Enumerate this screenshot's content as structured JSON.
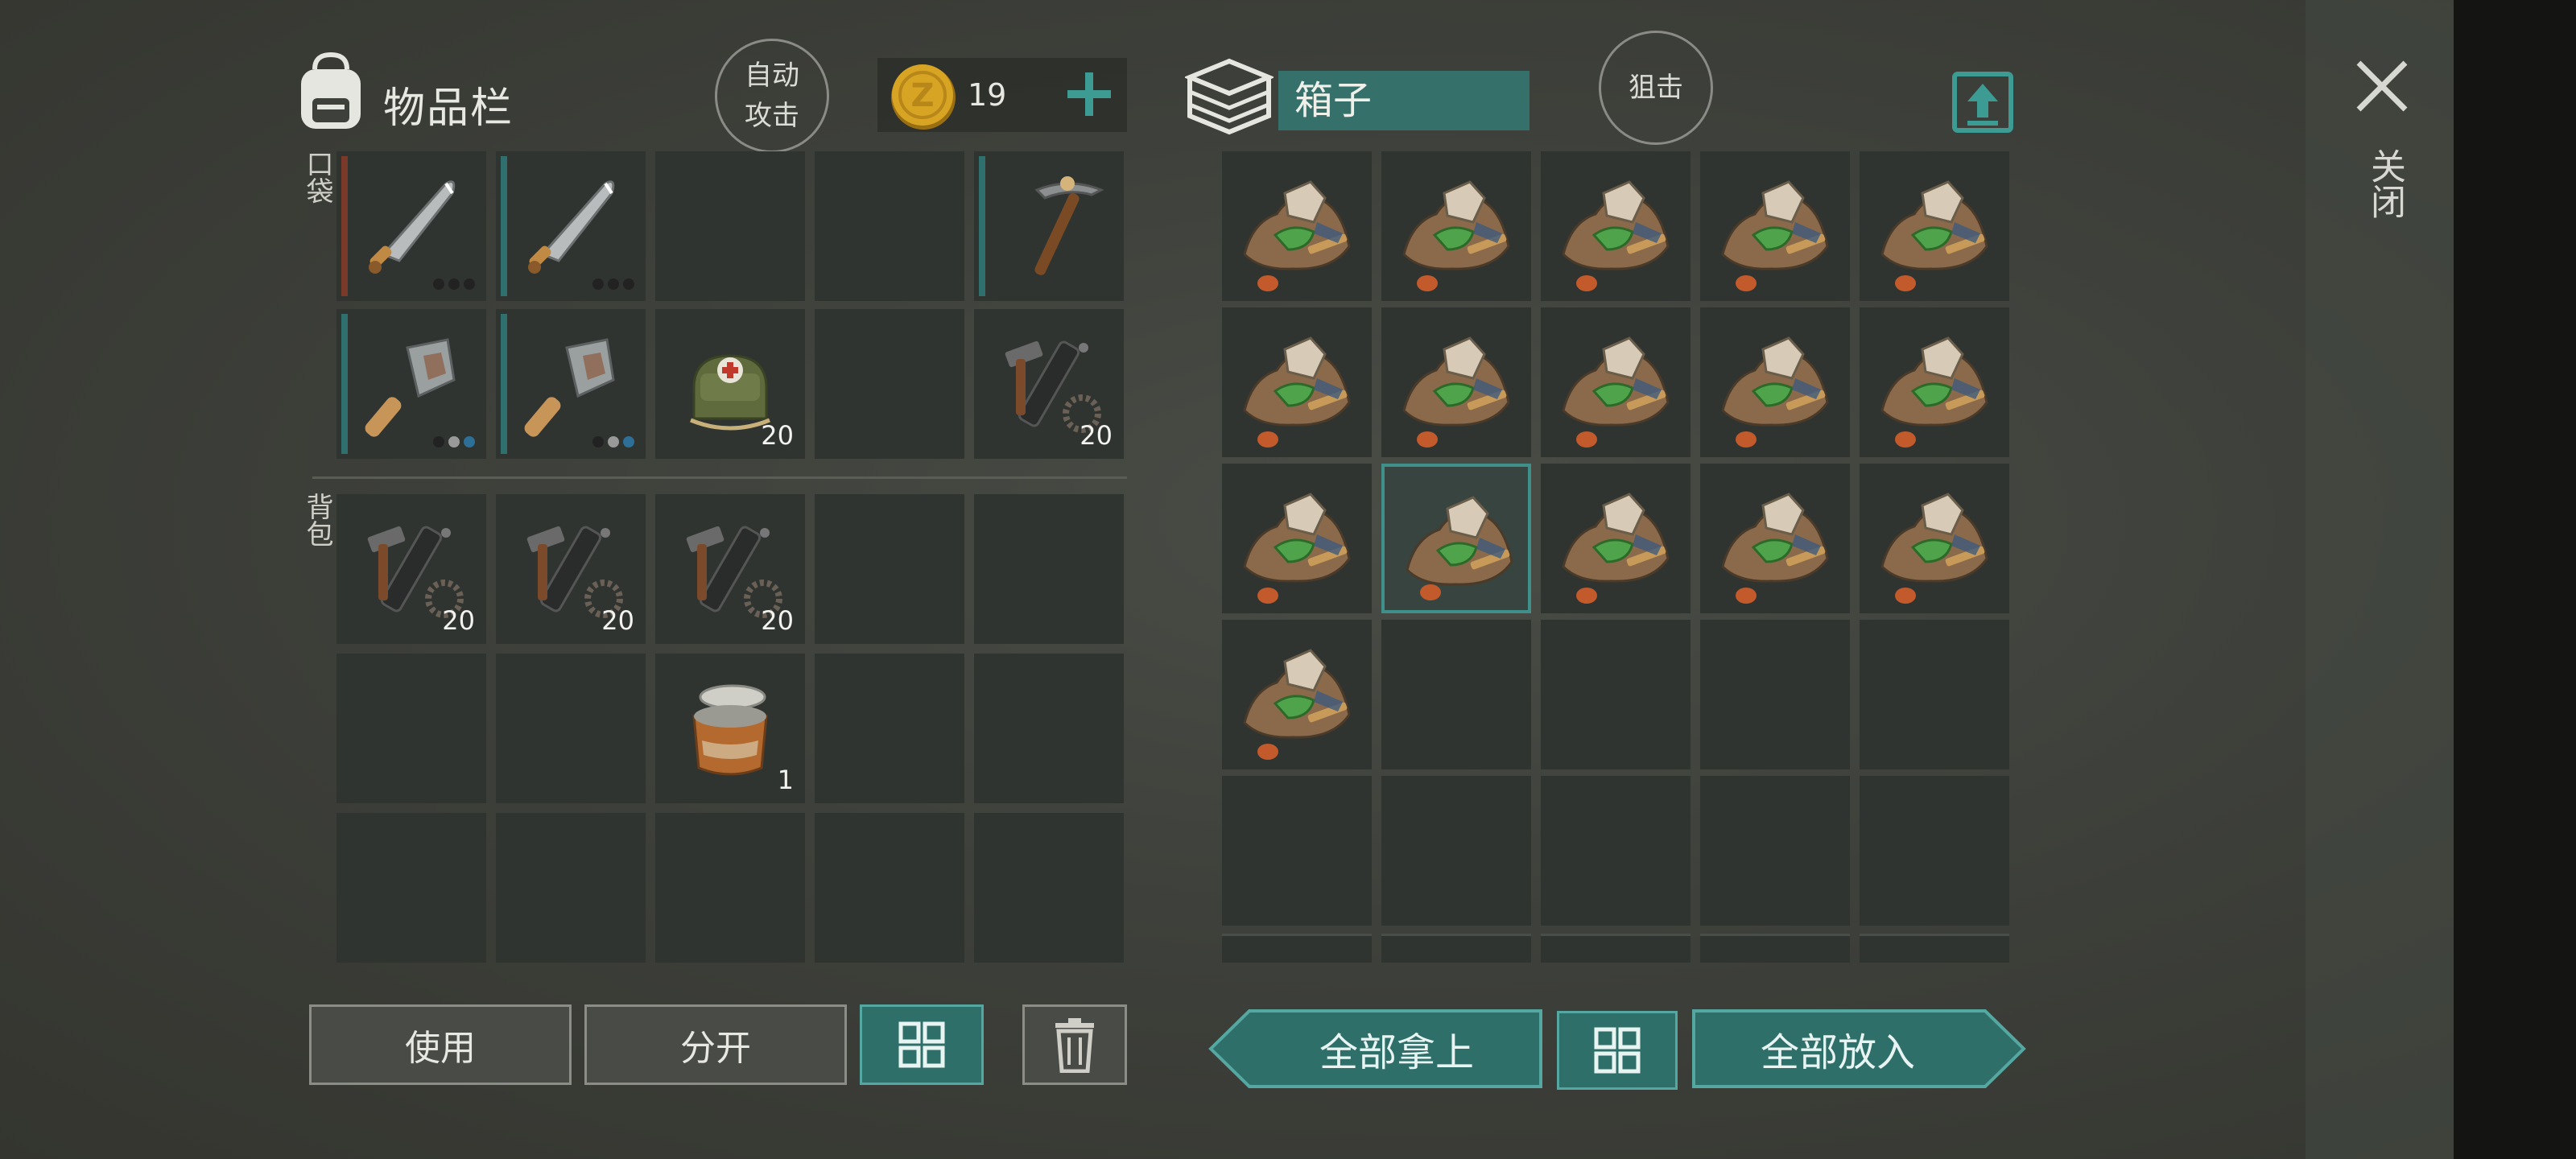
{
  "header": {
    "inventory_title": "物品栏",
    "auto_attack_label": "自动\n攻击",
    "coins": "19",
    "container_name": "箱子",
    "snipe_label": "狙击",
    "close_label": "关闭"
  },
  "sections": {
    "pockets_label": "口袋",
    "backpack_label": "背包"
  },
  "pockets": [
    {
      "item": "machete-icon",
      "count": "",
      "dots": [
        "#222",
        "#222",
        "#222"
      ],
      "bar": "#7a3a2a"
    },
    {
      "item": "machete-icon",
      "count": "",
      "dots": [
        "#222",
        "#222",
        "#222"
      ],
      "bar": "#2f6f6d"
    },
    {
      "item": "",
      "count": ""
    },
    {
      "item": "",
      "count": ""
    },
    {
      "item": "pickaxe-icon",
      "count": "",
      "bar": "#2f6f6d"
    },
    {
      "item": "cleaver-icon",
      "count": "",
      "dots": [
        "#222",
        "#999",
        "#2d6f96"
      ],
      "bar": "#2f6f6d"
    },
    {
      "item": "cleaver-icon",
      "count": "",
      "dots": [
        "#222",
        "#999",
        "#2d6f96"
      ],
      "bar": "#2f6f6d"
    },
    {
      "item": "medkit-bag-icon",
      "count": "20"
    },
    {
      "item": "",
      "count": ""
    },
    {
      "item": "parts-icon",
      "count": "20"
    }
  ],
  "backpack": [
    {
      "item": "parts-icon",
      "count": "20"
    },
    {
      "item": "parts-icon",
      "count": "20"
    },
    {
      "item": "parts-icon",
      "count": "20"
    },
    {
      "item": "",
      "count": ""
    },
    {
      "item": "",
      "count": ""
    },
    {
      "item": "",
      "count": ""
    },
    {
      "item": "",
      "count": ""
    },
    {
      "item": "tin-can-icon",
      "count": "1"
    },
    {
      "item": "",
      "count": ""
    },
    {
      "item": "",
      "count": ""
    },
    {
      "item": "",
      "count": ""
    },
    {
      "item": "",
      "count": ""
    },
    {
      "item": "",
      "count": ""
    },
    {
      "item": "",
      "count": ""
    },
    {
      "item": "",
      "count": ""
    }
  ],
  "container_items": 16,
  "container_selected_index": 11,
  "buttons": {
    "use": "使用",
    "split": "分开",
    "take_all": "全部拿上",
    "put_all": "全部放入"
  },
  "colors": {
    "teal": "#2f6f6a",
    "teal_border": "#55a8a1",
    "coin": "#d7a424",
    "slot": "#2f3431"
  }
}
